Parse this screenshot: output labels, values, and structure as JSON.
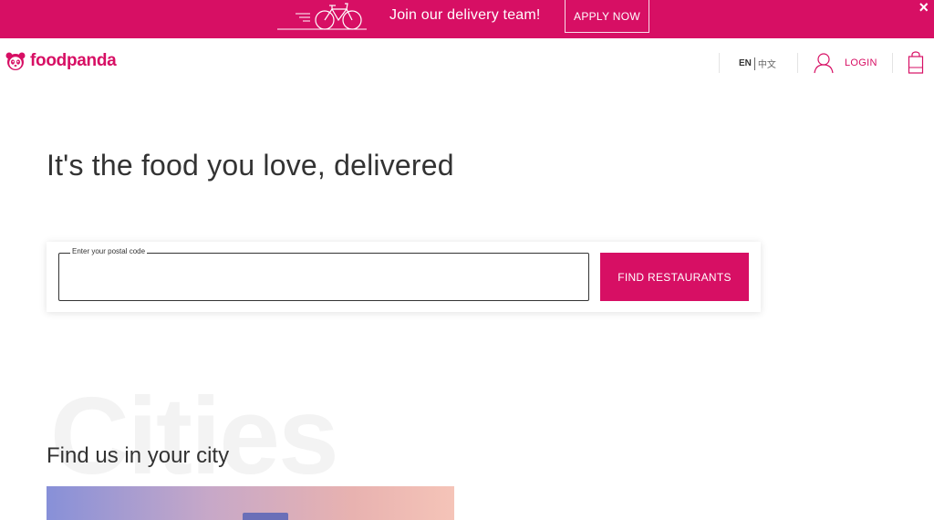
{
  "promo": {
    "text": "Join our delivery team!",
    "apply_label": "APPLY NOW",
    "close_label": "×",
    "bike_icon": "bicycle-icon"
  },
  "header": {
    "brand": "foodpanda",
    "lang_en": "EN",
    "lang_zh": "中文",
    "login_label": "LOGIN",
    "brand_color": "#d70f64"
  },
  "hero": {
    "title": "It's the food you love, delivered",
    "postal_legend": "Enter your postal code",
    "postal_value": "",
    "find_label": "FIND RESTAURANTS"
  },
  "cities": {
    "watermark": "Cities",
    "title": "Find us in your city"
  }
}
